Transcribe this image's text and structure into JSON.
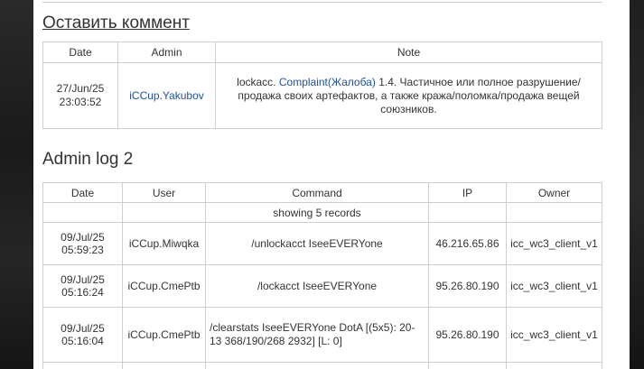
{
  "comment_section": {
    "title": "Оставить коммент",
    "headers": [
      "Date",
      "Admin",
      "Note"
    ],
    "rows": [
      {
        "date": "27/Jun/25",
        "time": "23:03:52",
        "admin": "iCCup.Yakubov",
        "note_prefix": "lockacc. ",
        "note_link": "Complaint(Жалоба)",
        "note_rest": " 1.4. Частичное или полное разрушение/продажа своих артефактов, а также кража/поломка/продажа вещей союзников."
      }
    ]
  },
  "admin_log": {
    "title": "Admin log 2",
    "headers": [
      "Date",
      "User",
      "Command",
      "IP",
      "Owner"
    ],
    "records_info": "showing 5 records",
    "rows": [
      {
        "date": "09/Jul/25",
        "time": "05:59:23",
        "user": "iCCup.Miwqka",
        "command": "/unlockacct IseeEVERYone",
        "ip": "46.216.65.86",
        "owner": "icc_wc3_client_v1"
      },
      {
        "date": "09/Jul/25",
        "time": "05:16:24",
        "user": "iCCup.CmePtb",
        "command": "/lockacct IseeEVERYone",
        "ip": "95.26.80.190",
        "owner": "icc_wc3_client_v1"
      },
      {
        "date": "09/Jul/25",
        "time": "05:16:04",
        "user": "iCCup.CmePtb",
        "command": "/clearstats IseeEVERYone DotA [(5x5): 20-13 368/190/268 2932] [L: 0]",
        "ip": "95.26.80.190",
        "owner": "icc_wc3_client_v1"
      }
    ]
  }
}
